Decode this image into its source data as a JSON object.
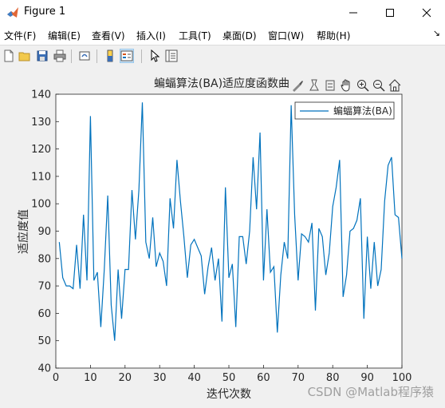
{
  "window": {
    "title": "Figure 1"
  },
  "menu": [
    "文件(F)",
    "编辑(E)",
    "查看(V)",
    "插入(I)",
    "工具(T)",
    "桌面(D)",
    "窗口(W)",
    "帮助(H)"
  ],
  "toolbar_icons": [
    "new-file-icon",
    "open-folder-icon",
    "save-icon",
    "print-icon",
    "link-icon",
    "colorbar-icon",
    "legend-icon",
    "pointer-icon",
    "property-inspector-icon"
  ],
  "axes_toolbar_icons": [
    "brush-icon",
    "data-tips-icon",
    "rotate-icon",
    "pan-icon",
    "zoom-in-icon",
    "zoom-out-icon",
    "home-icon"
  ],
  "watermark": "CSDN @Matlab程序猿",
  "chart_data": {
    "type": "line",
    "title": "蝙蝠算法(BA)适应度函数曲",
    "xlabel": "迭代次数",
    "ylabel": "适应度值",
    "xlim": [
      0,
      100
    ],
    "ylim": [
      40,
      140
    ],
    "xticks": [
      0,
      10,
      20,
      30,
      40,
      50,
      60,
      70,
      80,
      90,
      100
    ],
    "yticks": [
      40,
      50,
      60,
      70,
      80,
      90,
      100,
      110,
      120,
      130,
      140
    ],
    "grid": false,
    "legend_position": "top-right",
    "series": [
      {
        "name": "蝙蝠算法(BA)",
        "color": "#0072bd",
        "x": [
          1,
          2,
          3,
          4,
          5,
          6,
          7,
          8,
          9,
          10,
          11,
          12,
          13,
          14,
          15,
          16,
          17,
          18,
          19,
          20,
          21,
          22,
          23,
          24,
          25,
          26,
          27,
          28,
          29,
          30,
          31,
          32,
          33,
          34,
          35,
          36,
          37,
          38,
          39,
          40,
          41,
          42,
          43,
          44,
          45,
          46,
          47,
          48,
          49,
          50,
          51,
          52,
          53,
          54,
          55,
          56,
          57,
          58,
          59,
          60,
          61,
          62,
          63,
          64,
          65,
          66,
          67,
          68,
          69,
          70,
          71,
          72,
          73,
          74,
          75,
          76,
          77,
          78,
          79,
          80,
          81,
          82,
          83,
          84,
          85,
          86,
          87,
          88,
          89,
          90,
          91,
          92,
          93,
          94,
          95,
          96,
          97,
          98,
          99,
          100
        ],
        "values": [
          86,
          73,
          70,
          70,
          69,
          85,
          69,
          96,
          72,
          132,
          72,
          75,
          55,
          76,
          103,
          63,
          50,
          76,
          58,
          76,
          76,
          105,
          87,
          105,
          137,
          86,
          80,
          95,
          77,
          82,
          79,
          70,
          102,
          91,
          116,
          101,
          88,
          73,
          85,
          87,
          84,
          81,
          67,
          77,
          84,
          72,
          80,
          57,
          106,
          73,
          78,
          55,
          88,
          88,
          78,
          90,
          117,
          98,
          126,
          72,
          98,
          75,
          77,
          53,
          74,
          86,
          80,
          136,
          96,
          72,
          89,
          88,
          86,
          93,
          61,
          91,
          88,
          74,
          82,
          99,
          106,
          116,
          66,
          74,
          90,
          91,
          94,
          102,
          58,
          88,
          69,
          86,
          70,
          76,
          101,
          114,
          117,
          96,
          95,
          80
        ]
      }
    ]
  }
}
